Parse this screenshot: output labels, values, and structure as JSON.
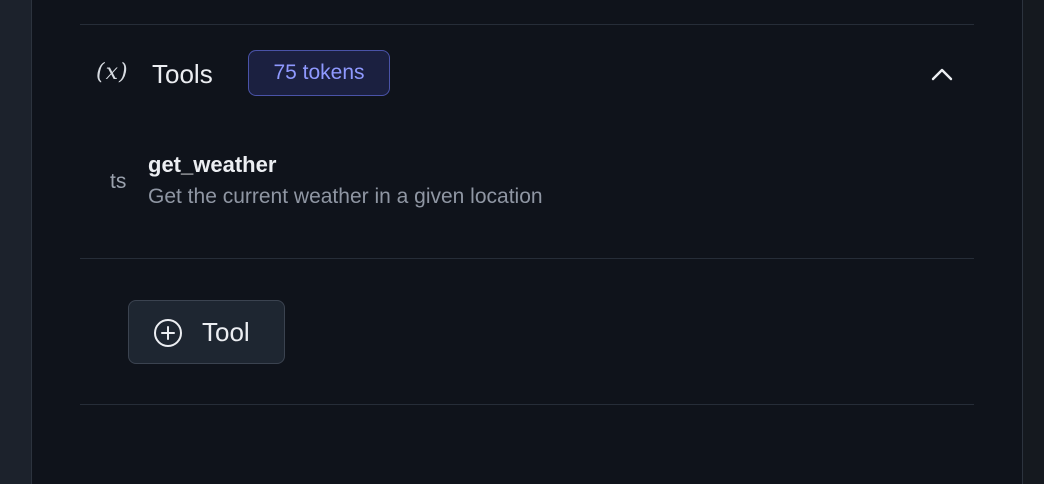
{
  "tools_section": {
    "icon": "function-variable-icon",
    "icon_glyph": "(x)",
    "title": "Tools",
    "token_badge": "75 tokens",
    "collapse_icon": "chevron-up-icon"
  },
  "tools": [
    {
      "language_icon": "ts",
      "name": "get_weather",
      "description": "Get the current weather in a given location"
    }
  ],
  "add_tool_button": {
    "icon": "plus-circle-icon",
    "label": "Tool"
  },
  "colors": {
    "panel_bg": "#0f131b",
    "badge_text": "#8f99ff",
    "badge_border": "#4a53a8",
    "text_primary": "#eceef2",
    "text_muted": "#8f96a3"
  }
}
